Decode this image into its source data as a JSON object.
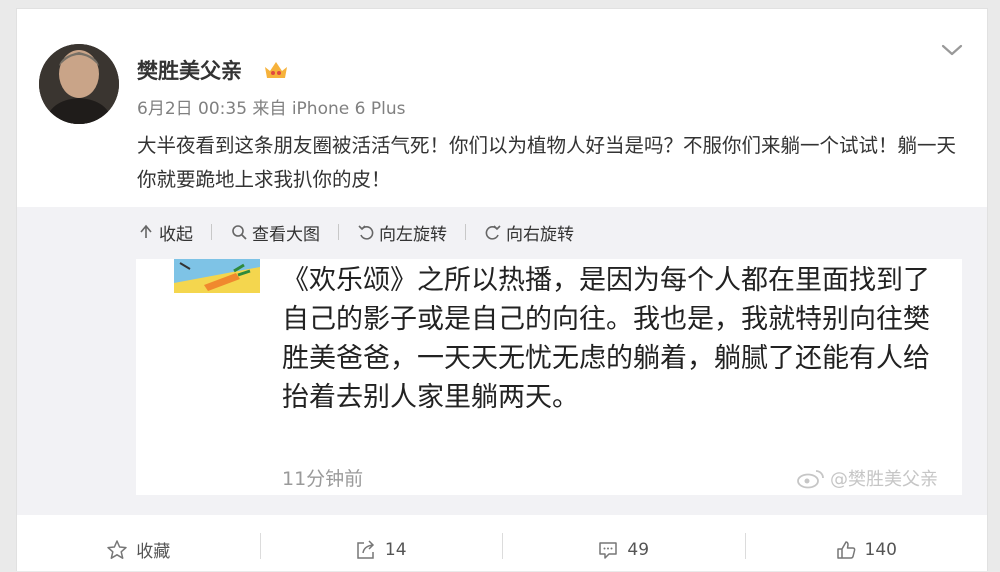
{
  "post": {
    "author": "樊胜美父亲",
    "meta": "6月2日 00:35 来自 iPhone 6 Plus",
    "text": "大半夜看到这条朋友圈被活活气死！你们以为植物人好当是吗？不服你们来躺一个试试！躺一天你就要跪地上求我扒你的皮！"
  },
  "media_toolbar": {
    "collapse": "收起",
    "view_large": "查看大图",
    "rotate_left": "向左旋转",
    "rotate_right": "向右旋转"
  },
  "screenshot": {
    "text": "《欢乐颂》之所以热播，是因为每个人都在里面找到了自己的影子或是自己的向往。我也是，我就特别向往樊胜美爸爸，一天天无忧无虑的躺着，躺腻了还能有人给抬着去别人家里躺两天。",
    "time": "11分钟前",
    "watermark": "@樊胜美父亲"
  },
  "actions": {
    "favorite": "收藏",
    "repost": "14",
    "comment": "49",
    "like": "140"
  },
  "colors": {
    "background": "#eaeaea",
    "card": "#ffffff",
    "media_bg": "#f2f2f5",
    "meta_text": "#808080"
  }
}
